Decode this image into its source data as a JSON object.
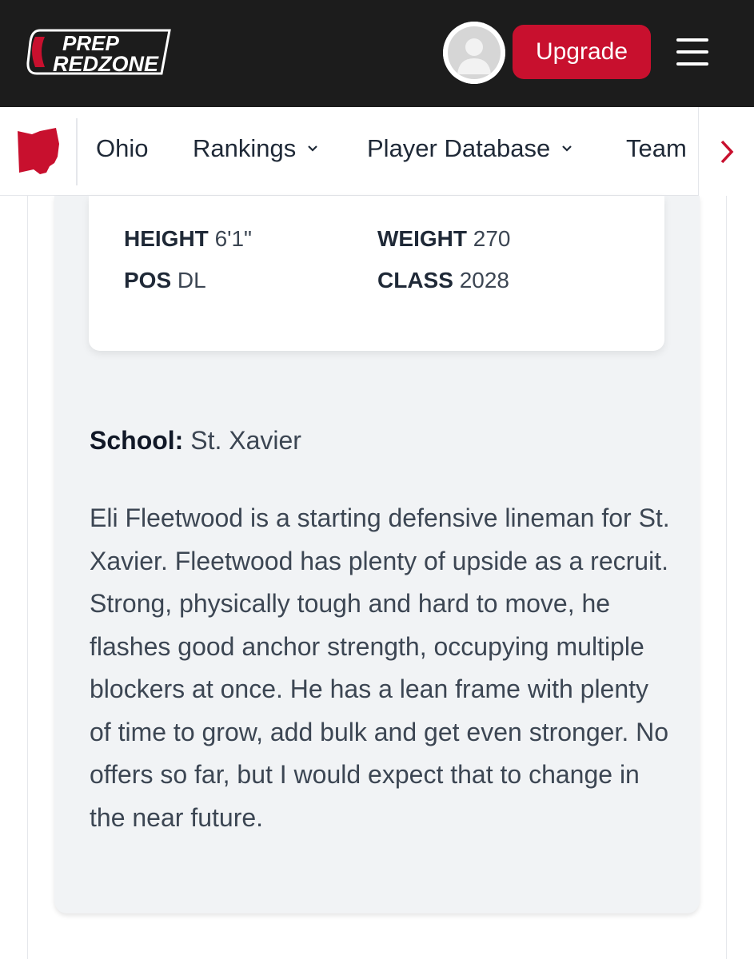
{
  "header": {
    "logo_text_top": "PREP",
    "logo_text_bottom": "REDZONE",
    "upgrade_label": "Upgrade",
    "brand_color": "#c8102e"
  },
  "nav": {
    "items": [
      {
        "label": "Ohio"
      },
      {
        "label": "Rankings"
      },
      {
        "label": "Player Database"
      },
      {
        "label": "Team"
      }
    ]
  },
  "player": {
    "stats": {
      "height_label": "HEIGHT",
      "height_value": "6'1\"",
      "weight_label": "WEIGHT",
      "weight_value": "270",
      "pos_label": "POS",
      "pos_value": "DL",
      "class_label": "CLASS",
      "class_value": "2028"
    },
    "school_label": "School:",
    "school_value": "St. Xavier",
    "bio": "Eli Fleetwood is a starting defensive lineman for St. Xavier. Fleetwood has plenty of upside as a recruit. Strong, physically tough and hard to move, he flashes good anchor strength, occupying multiple blockers at once. He has a lean frame with plenty of time to grow, add bulk and get even stronger. No offers so far, but I would expect that to change in the near future."
  }
}
